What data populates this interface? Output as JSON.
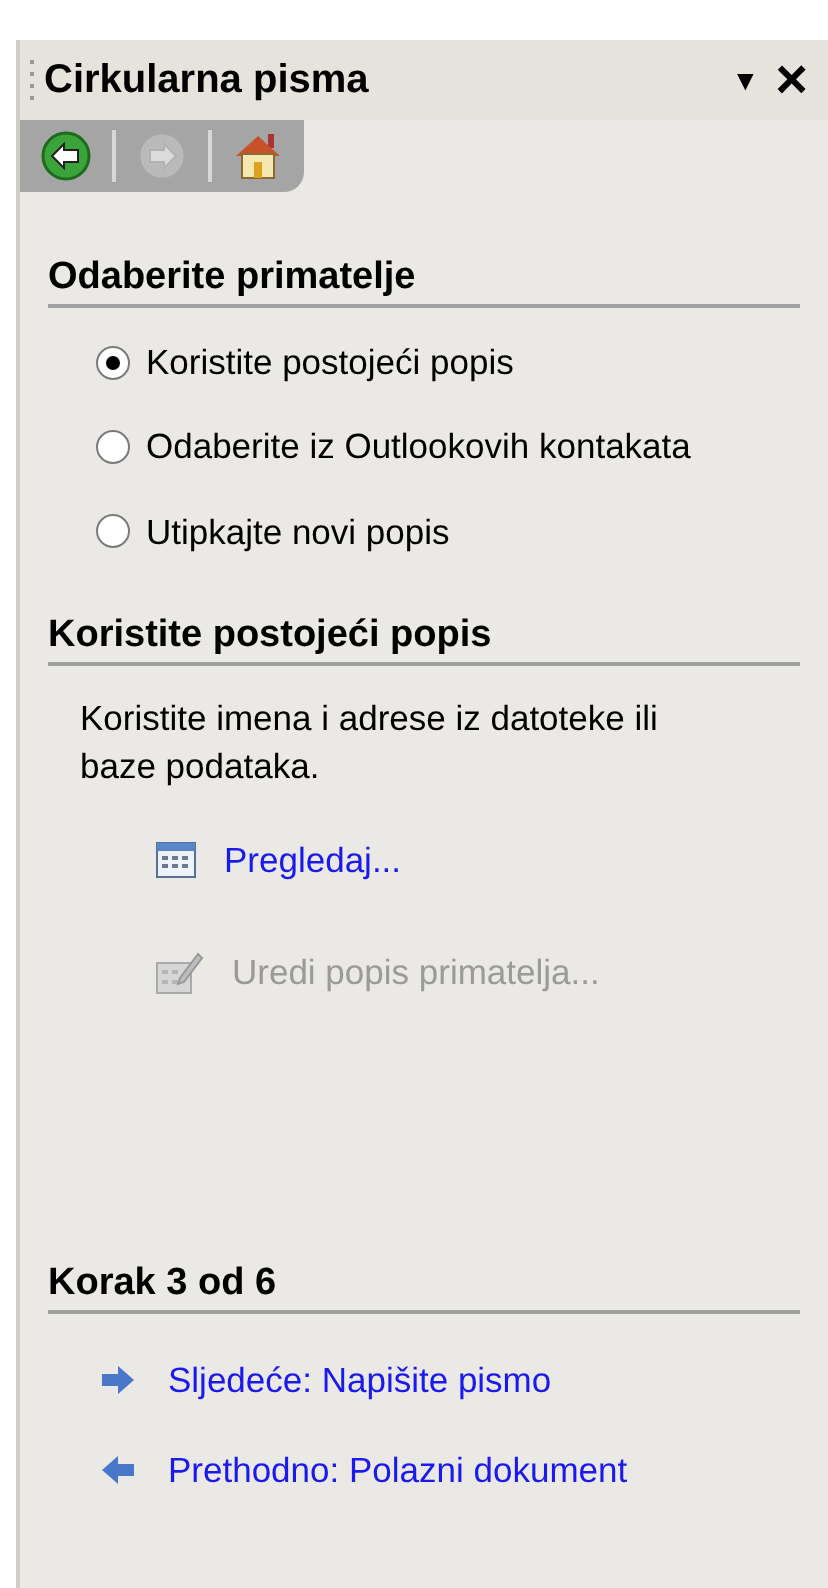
{
  "panel": {
    "title": "Cirkularna pisma",
    "menu_glyph": "▼",
    "close_glyph": "×"
  },
  "nav": [
    {
      "kind": "back",
      "disabled": false
    },
    {
      "kind": "forward",
      "disabled": true
    },
    {
      "kind": "home",
      "disabled": false
    }
  ],
  "section_1": {
    "heading": "Odaberite primatelje",
    "options": [
      {
        "label": "Koristite postojeći popis",
        "selected": true
      },
      {
        "label": "Odaberite iz Outlookovih kontakata",
        "selected": false
      },
      {
        "label": "Utipkajte novi popis",
        "selected": false
      }
    ]
  },
  "section_2": {
    "heading": "Koristite postojeći popis",
    "description": "Koristite imena i adrese iz datoteke ili baze podataka.",
    "links": [
      {
        "kind": "browse",
        "label": "Pregledaj...",
        "disabled": false
      },
      {
        "kind": "edit",
        "label": "Uredi popis primatelja...",
        "disabled": true
      }
    ]
  },
  "section_3": {
    "heading": "Korak 3 od 6",
    "links": [
      {
        "kind": "next",
        "label": "Sljedeće: Napišite pismo"
      },
      {
        "kind": "previous",
        "label": "Prethodno: Polazni dokument"
      }
    ]
  }
}
